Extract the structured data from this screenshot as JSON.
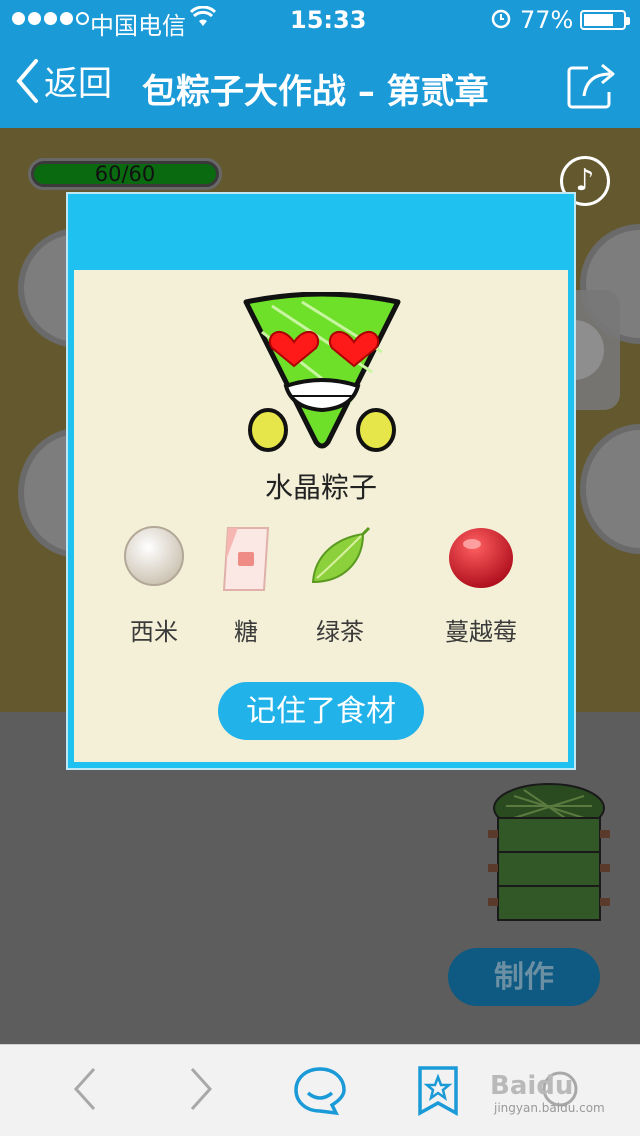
{
  "status_bar": {
    "carrier": "中国电信",
    "time": "15:33",
    "battery_percent": "77%",
    "battery_level": 0.77
  },
  "nav": {
    "back_label": "返回",
    "title": "包粽子大作战 – 第贰章"
  },
  "game": {
    "hp_text": "60/60",
    "hp_level": 1.0,
    "make_button_label": "制作"
  },
  "modal": {
    "zongzi_name": "水晶粽子",
    "ingredients": [
      {
        "label": "西米",
        "icon": "sago-ball-icon"
      },
      {
        "label": "糖",
        "icon": "sugar-packet-icon"
      },
      {
        "label": "绿茶",
        "icon": "green-tea-leaf-icon"
      },
      {
        "label": "蔓越莓",
        "icon": "cranberry-icon"
      }
    ],
    "confirm_button_label": "记住了食材"
  },
  "toolbar": {
    "watermark_brand": "Baidu",
    "watermark_site": "jingyan.baidu.com",
    "icons": [
      "back-arrow-icon",
      "forward-arrow-icon",
      "chat-icon",
      "bookmark-star-icon",
      "more-icon"
    ]
  },
  "colors": {
    "nav_blue": "#1b9ad8",
    "modal_blue": "#1ec1ef",
    "panel_cream": "#f3f0d7",
    "button_blue": "#21b2ea"
  }
}
